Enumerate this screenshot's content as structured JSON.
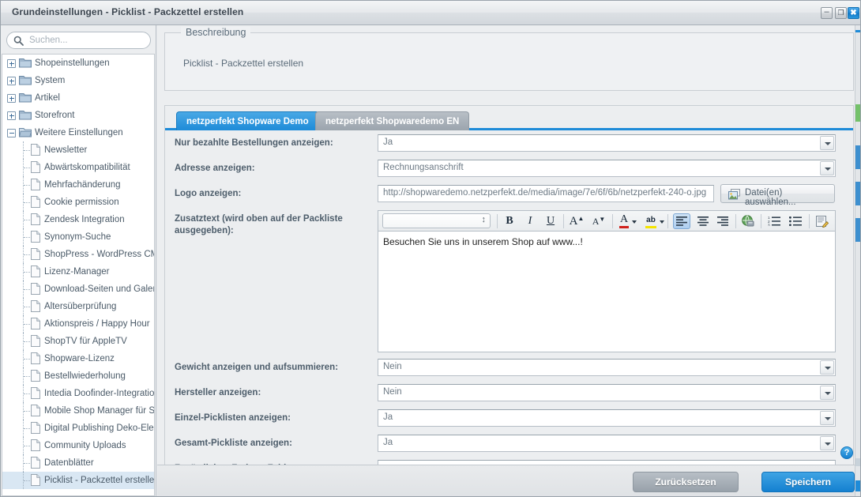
{
  "window": {
    "title": "Grundeinstellungen - Picklist - Packzettel erstellen",
    "minimize_label": "–",
    "maximize_label": "❐",
    "close_label": "✖",
    "accent": "#1e8bd8"
  },
  "sidebar": {
    "search": {
      "placeholder": "Suchen...",
      "value": ""
    },
    "tree": [
      {
        "label": "Shopeinstellungen",
        "type": "folder",
        "depth": 0,
        "expanded": false,
        "selected": false
      },
      {
        "label": "System",
        "type": "folder",
        "depth": 0,
        "expanded": false,
        "selected": false
      },
      {
        "label": "Artikel",
        "type": "folder",
        "depth": 0,
        "expanded": false,
        "selected": false
      },
      {
        "label": "Storefront",
        "type": "folder",
        "depth": 0,
        "expanded": false,
        "selected": false
      },
      {
        "label": "Weitere Einstellungen",
        "type": "folder",
        "depth": 0,
        "expanded": true,
        "selected": false
      },
      {
        "label": "Newsletter",
        "type": "file",
        "depth": 1,
        "selected": false
      },
      {
        "label": "Abwärtskompatibilität",
        "type": "file",
        "depth": 1,
        "selected": false
      },
      {
        "label": "Mehrfachänderung",
        "type": "file",
        "depth": 1,
        "selected": false
      },
      {
        "label": "Cookie permission",
        "type": "file",
        "depth": 1,
        "selected": false
      },
      {
        "label": "Zendesk Integration",
        "type": "file",
        "depth": 1,
        "selected": false
      },
      {
        "label": "Synonym-Suche",
        "type": "file",
        "depth": 1,
        "selected": false
      },
      {
        "label": "ShopPress - WordPress CMS-",
        "type": "file",
        "depth": 1,
        "selected": false
      },
      {
        "label": "Lizenz-Manager",
        "type": "file",
        "depth": 1,
        "selected": false
      },
      {
        "label": "Download-Seiten und Galerie",
        "type": "file",
        "depth": 1,
        "selected": false
      },
      {
        "label": "Altersüberprüfung",
        "type": "file",
        "depth": 1,
        "selected": false
      },
      {
        "label": "Aktionspreis / Happy Hour",
        "type": "file",
        "depth": 1,
        "selected": false
      },
      {
        "label": "ShopTV für AppleTV",
        "type": "file",
        "depth": 1,
        "selected": false
      },
      {
        "label": "Shopware-Lizenz",
        "type": "file",
        "depth": 1,
        "selected": false
      },
      {
        "label": "Bestellwiederholung",
        "type": "file",
        "depth": 1,
        "selected": false
      },
      {
        "label": "Intedia Doofinder-Integration",
        "type": "file",
        "depth": 1,
        "selected": false
      },
      {
        "label": "Mobile Shop Manager für Sho",
        "type": "file",
        "depth": 1,
        "selected": false
      },
      {
        "label": "Digital Publishing Deko-Eleme",
        "type": "file",
        "depth": 1,
        "selected": false
      },
      {
        "label": "Community Uploads",
        "type": "file",
        "depth": 1,
        "selected": false
      },
      {
        "label": "Datenblätter",
        "type": "file",
        "depth": 1,
        "selected": false
      },
      {
        "label": "Picklist - Packzettel erstellen",
        "type": "file",
        "depth": 1,
        "selected": true
      }
    ]
  },
  "description": {
    "legend": "Beschreibung",
    "text": "Picklist - Packzettel erstellen"
  },
  "tabs": [
    {
      "label": "netzperfekt Shopware Demo",
      "active": true
    },
    {
      "label": "netzperfekt Shopwaredemo EN",
      "active": false
    }
  ],
  "form": {
    "fields": [
      {
        "label": "Nur bezahlte Bestellungen anzeigen:",
        "value": "Ja",
        "control": "select"
      },
      {
        "label": "Adresse anzeigen:",
        "value": "Rechnungsanschrift",
        "control": "select"
      },
      {
        "label": "Logo anzeigen:",
        "value": "http://shopwaredemo.netzperfekt.de/media/image/7e/6f/6b/netzperfekt-240-o.jpg",
        "control": "text"
      },
      {
        "label": "Zusatztext (wird oben auf der Packliste ausgegeben):",
        "value": "Besuchen Sie uns in unserem Shop auf www...!",
        "control": "richtext"
      },
      {
        "label": "Gewicht anzeigen und aufsummieren:",
        "value": "Nein",
        "control": "select"
      },
      {
        "label": "Hersteller anzeigen:",
        "value": "Nein",
        "control": "select"
      },
      {
        "label": "Einzel-Picklisten anzeigen:",
        "value": "Ja",
        "control": "select"
      },
      {
        "label": "Gesamt-Pickliste anzeigen:",
        "value": "Ja",
        "control": "select"
      },
      {
        "label": "Zusätzliches Freitext-Feld:",
        "value": "",
        "control": "text"
      }
    ],
    "file_button_label": "Datei(en) auswählen..."
  },
  "editor": {
    "font_select_value": "",
    "content": "Besuchen Sie uns in unserem Shop auf www...!",
    "toolbar": [
      {
        "name": "bold-icon",
        "glyph": "B"
      },
      {
        "name": "italic-icon",
        "glyph": "I"
      },
      {
        "name": "underline-icon",
        "glyph": "U"
      },
      {
        "name": "font-size-increase-icon",
        "glyph": "A"
      },
      {
        "name": "font-size-decrease-icon",
        "glyph": "A"
      },
      {
        "name": "text-color-icon",
        "glyph": "A"
      },
      {
        "name": "highlight-color-icon",
        "glyph": "ab"
      },
      {
        "name": "align-left-icon",
        "glyph": "≡"
      },
      {
        "name": "align-center-icon",
        "glyph": "≡"
      },
      {
        "name": "align-right-icon",
        "glyph": "≡"
      },
      {
        "name": "insert-link-icon",
        "glyph": "●"
      },
      {
        "name": "ordered-list-icon",
        "glyph": "≣"
      },
      {
        "name": "unordered-list-icon",
        "glyph": "≣"
      },
      {
        "name": "source-code-icon",
        "glyph": "✎"
      }
    ]
  },
  "footer": {
    "reset_label": "Zurücksetzen",
    "save_label": "Speichern",
    "help_label": "?"
  }
}
